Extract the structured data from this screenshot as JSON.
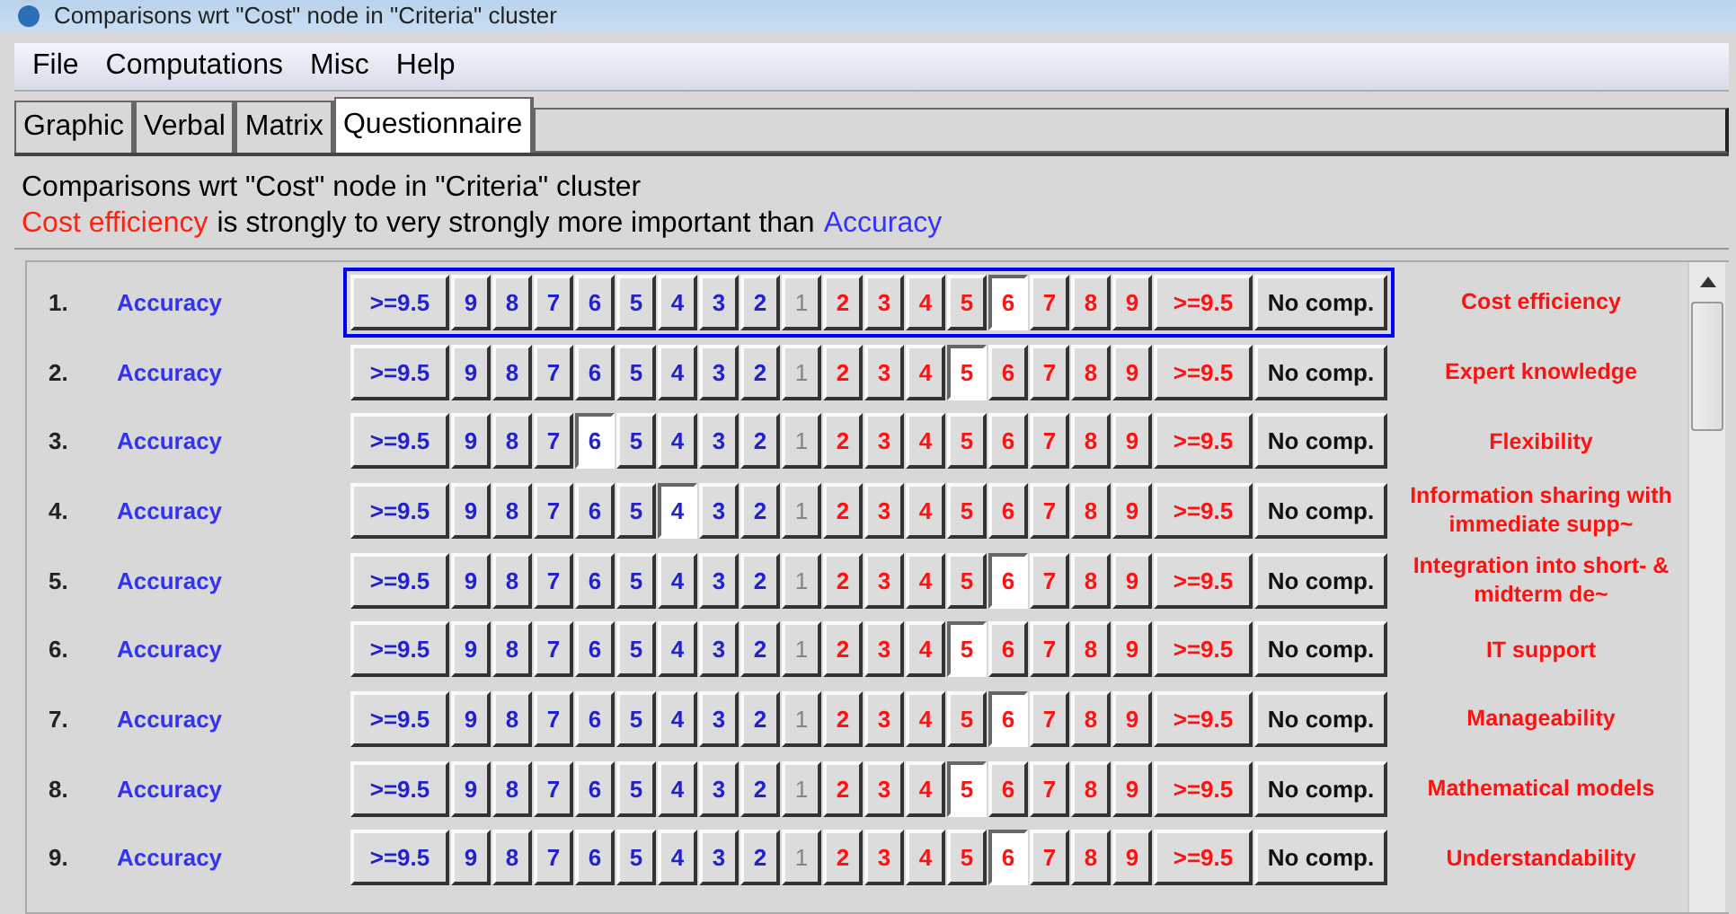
{
  "window": {
    "title": "Comparisons wrt \"Cost\" node in \"Criteria\" cluster"
  },
  "menu": [
    "File",
    "Computations",
    "Misc",
    "Help"
  ],
  "tabs": [
    {
      "label": "Graphic",
      "selected": false
    },
    {
      "label": "Verbal",
      "selected": false
    },
    {
      "label": "Matrix",
      "selected": false
    },
    {
      "label": "Questionnaire",
      "selected": true
    }
  ],
  "header": {
    "line": "Comparisons wrt \"Cost\" node in \"Criteria\" cluster",
    "verdict_left": "Cost efficiency",
    "verdict_middle": "is strongly to very strongly more important than",
    "verdict_right": "Accuracy"
  },
  "rows": [
    {
      "number": "1.",
      "left": "Accuracy",
      "right": "Cost efficiency",
      "focused": true,
      "scale": [
        {
          "label": ">=9.5",
          "kind": "left",
          "selected": false
        },
        {
          "label": "9",
          "kind": "left",
          "selected": false
        },
        {
          "label": "8",
          "kind": "left",
          "selected": false
        },
        {
          "label": "7",
          "kind": "left",
          "selected": false
        },
        {
          "label": "6",
          "kind": "left",
          "selected": false
        },
        {
          "label": "5",
          "kind": "left",
          "selected": false
        },
        {
          "label": "4",
          "kind": "left",
          "selected": false
        },
        {
          "label": "3",
          "kind": "left",
          "selected": false
        },
        {
          "label": "2",
          "kind": "left",
          "selected": false
        },
        {
          "label": "1",
          "kind": "equal",
          "selected": false
        },
        {
          "label": "2",
          "kind": "right",
          "selected": false
        },
        {
          "label": "3",
          "kind": "right",
          "selected": false
        },
        {
          "label": "4",
          "kind": "right",
          "selected": false
        },
        {
          "label": "5",
          "kind": "right",
          "selected": false
        },
        {
          "label": "6",
          "kind": "right",
          "selected": true
        },
        {
          "label": "7",
          "kind": "right",
          "selected": false
        },
        {
          "label": "8",
          "kind": "right",
          "selected": false
        },
        {
          "label": "9",
          "kind": "right",
          "selected": false
        },
        {
          "label": ">=9.5",
          "kind": "right",
          "selected": false
        },
        {
          "label": "No comp.",
          "kind": "none",
          "selected": false
        }
      ]
    },
    {
      "number": "2.",
      "left": "Accuracy",
      "right": "Expert knowledge",
      "focused": false,
      "scale": [
        {
          "label": ">=9.5",
          "kind": "left",
          "selected": false
        },
        {
          "label": "9",
          "kind": "left",
          "selected": false
        },
        {
          "label": "8",
          "kind": "left",
          "selected": false
        },
        {
          "label": "7",
          "kind": "left",
          "selected": false
        },
        {
          "label": "6",
          "kind": "left",
          "selected": false
        },
        {
          "label": "5",
          "kind": "left",
          "selected": false
        },
        {
          "label": "4",
          "kind": "left",
          "selected": false
        },
        {
          "label": "3",
          "kind": "left",
          "selected": false
        },
        {
          "label": "2",
          "kind": "left",
          "selected": false
        },
        {
          "label": "1",
          "kind": "equal",
          "selected": false
        },
        {
          "label": "2",
          "kind": "right",
          "selected": false
        },
        {
          "label": "3",
          "kind": "right",
          "selected": false
        },
        {
          "label": "4",
          "kind": "right",
          "selected": false
        },
        {
          "label": "5",
          "kind": "right",
          "selected": true
        },
        {
          "label": "6",
          "kind": "right",
          "selected": false
        },
        {
          "label": "7",
          "kind": "right",
          "selected": false
        },
        {
          "label": "8",
          "kind": "right",
          "selected": false
        },
        {
          "label": "9",
          "kind": "right",
          "selected": false
        },
        {
          "label": ">=9.5",
          "kind": "right",
          "selected": false
        },
        {
          "label": "No comp.",
          "kind": "none",
          "selected": false
        }
      ]
    },
    {
      "number": "3.",
      "left": "Accuracy",
      "right": "Flexibility",
      "focused": false,
      "scale": [
        {
          "label": ">=9.5",
          "kind": "left",
          "selected": false
        },
        {
          "label": "9",
          "kind": "left",
          "selected": false
        },
        {
          "label": "8",
          "kind": "left",
          "selected": false
        },
        {
          "label": "7",
          "kind": "left",
          "selected": false
        },
        {
          "label": "6",
          "kind": "left",
          "selected": true
        },
        {
          "label": "5",
          "kind": "left",
          "selected": false
        },
        {
          "label": "4",
          "kind": "left",
          "selected": false
        },
        {
          "label": "3",
          "kind": "left",
          "selected": false
        },
        {
          "label": "2",
          "kind": "left",
          "selected": false
        },
        {
          "label": "1",
          "kind": "equal",
          "selected": false
        },
        {
          "label": "2",
          "kind": "right",
          "selected": false
        },
        {
          "label": "3",
          "kind": "right",
          "selected": false
        },
        {
          "label": "4",
          "kind": "right",
          "selected": false
        },
        {
          "label": "5",
          "kind": "right",
          "selected": false
        },
        {
          "label": "6",
          "kind": "right",
          "selected": false
        },
        {
          "label": "7",
          "kind": "right",
          "selected": false
        },
        {
          "label": "8",
          "kind": "right",
          "selected": false
        },
        {
          "label": "9",
          "kind": "right",
          "selected": false
        },
        {
          "label": ">=9.5",
          "kind": "right",
          "selected": false
        },
        {
          "label": "No comp.",
          "kind": "none",
          "selected": false
        }
      ]
    },
    {
      "number": "4.",
      "left": "Accuracy",
      "right": "Information sharing with immediate supp~",
      "focused": false,
      "scale": [
        {
          "label": ">=9.5",
          "kind": "left",
          "selected": false
        },
        {
          "label": "9",
          "kind": "left",
          "selected": false
        },
        {
          "label": "8",
          "kind": "left",
          "selected": false
        },
        {
          "label": "7",
          "kind": "left",
          "selected": false
        },
        {
          "label": "6",
          "kind": "left",
          "selected": false
        },
        {
          "label": "5",
          "kind": "left",
          "selected": false
        },
        {
          "label": "4",
          "kind": "left",
          "selected": true
        },
        {
          "label": "3",
          "kind": "left",
          "selected": false
        },
        {
          "label": "2",
          "kind": "left",
          "selected": false
        },
        {
          "label": "1",
          "kind": "equal",
          "selected": false
        },
        {
          "label": "2",
          "kind": "right",
          "selected": false
        },
        {
          "label": "3",
          "kind": "right",
          "selected": false
        },
        {
          "label": "4",
          "kind": "right",
          "selected": false
        },
        {
          "label": "5",
          "kind": "right",
          "selected": false
        },
        {
          "label": "6",
          "kind": "right",
          "selected": false
        },
        {
          "label": "7",
          "kind": "right",
          "selected": false
        },
        {
          "label": "8",
          "kind": "right",
          "selected": false
        },
        {
          "label": "9",
          "kind": "right",
          "selected": false
        },
        {
          "label": ">=9.5",
          "kind": "right",
          "selected": false
        },
        {
          "label": "No comp.",
          "kind": "none",
          "selected": false
        }
      ]
    },
    {
      "number": "5.",
      "left": "Accuracy",
      "right": "Integration into short- & midterm de~",
      "focused": false,
      "scale": [
        {
          "label": ">=9.5",
          "kind": "left",
          "selected": false
        },
        {
          "label": "9",
          "kind": "left",
          "selected": false
        },
        {
          "label": "8",
          "kind": "left",
          "selected": false
        },
        {
          "label": "7",
          "kind": "left",
          "selected": false
        },
        {
          "label": "6",
          "kind": "left",
          "selected": false
        },
        {
          "label": "5",
          "kind": "left",
          "selected": false
        },
        {
          "label": "4",
          "kind": "left",
          "selected": false
        },
        {
          "label": "3",
          "kind": "left",
          "selected": false
        },
        {
          "label": "2",
          "kind": "left",
          "selected": false
        },
        {
          "label": "1",
          "kind": "equal",
          "selected": false
        },
        {
          "label": "2",
          "kind": "right",
          "selected": false
        },
        {
          "label": "3",
          "kind": "right",
          "selected": false
        },
        {
          "label": "4",
          "kind": "right",
          "selected": false
        },
        {
          "label": "5",
          "kind": "right",
          "selected": false
        },
        {
          "label": "6",
          "kind": "right",
          "selected": true
        },
        {
          "label": "7",
          "kind": "right",
          "selected": false
        },
        {
          "label": "8",
          "kind": "right",
          "selected": false
        },
        {
          "label": "9",
          "kind": "right",
          "selected": false
        },
        {
          "label": ">=9.5",
          "kind": "right",
          "selected": false
        },
        {
          "label": "No comp.",
          "kind": "none",
          "selected": false
        }
      ]
    },
    {
      "number": "6.",
      "left": "Accuracy",
      "right": "IT support",
      "focused": false,
      "scale": [
        {
          "label": ">=9.5",
          "kind": "left",
          "selected": false
        },
        {
          "label": "9",
          "kind": "left",
          "selected": false
        },
        {
          "label": "8",
          "kind": "left",
          "selected": false
        },
        {
          "label": "7",
          "kind": "left",
          "selected": false
        },
        {
          "label": "6",
          "kind": "left",
          "selected": false
        },
        {
          "label": "5",
          "kind": "left",
          "selected": false
        },
        {
          "label": "4",
          "kind": "left",
          "selected": false
        },
        {
          "label": "3",
          "kind": "left",
          "selected": false
        },
        {
          "label": "2",
          "kind": "left",
          "selected": false
        },
        {
          "label": "1",
          "kind": "equal",
          "selected": false
        },
        {
          "label": "2",
          "kind": "right",
          "selected": false
        },
        {
          "label": "3",
          "kind": "right",
          "selected": false
        },
        {
          "label": "4",
          "kind": "right",
          "selected": false
        },
        {
          "label": "5",
          "kind": "right",
          "selected": true
        },
        {
          "label": "6",
          "kind": "right",
          "selected": false
        },
        {
          "label": "7",
          "kind": "right",
          "selected": false
        },
        {
          "label": "8",
          "kind": "right",
          "selected": false
        },
        {
          "label": "9",
          "kind": "right",
          "selected": false
        },
        {
          "label": ">=9.5",
          "kind": "right",
          "selected": false
        },
        {
          "label": "No comp.",
          "kind": "none",
          "selected": false
        }
      ]
    },
    {
      "number": "7.",
      "left": "Accuracy",
      "right": "Manageability",
      "focused": false,
      "scale": [
        {
          "label": ">=9.5",
          "kind": "left",
          "selected": false
        },
        {
          "label": "9",
          "kind": "left",
          "selected": false
        },
        {
          "label": "8",
          "kind": "left",
          "selected": false
        },
        {
          "label": "7",
          "kind": "left",
          "selected": false
        },
        {
          "label": "6",
          "kind": "left",
          "selected": false
        },
        {
          "label": "5",
          "kind": "left",
          "selected": false
        },
        {
          "label": "4",
          "kind": "left",
          "selected": false
        },
        {
          "label": "3",
          "kind": "left",
          "selected": false
        },
        {
          "label": "2",
          "kind": "left",
          "selected": false
        },
        {
          "label": "1",
          "kind": "equal",
          "selected": false
        },
        {
          "label": "2",
          "kind": "right",
          "selected": false
        },
        {
          "label": "3",
          "kind": "right",
          "selected": false
        },
        {
          "label": "4",
          "kind": "right",
          "selected": false
        },
        {
          "label": "5",
          "kind": "right",
          "selected": false
        },
        {
          "label": "6",
          "kind": "right",
          "selected": true
        },
        {
          "label": "7",
          "kind": "right",
          "selected": false
        },
        {
          "label": "8",
          "kind": "right",
          "selected": false
        },
        {
          "label": "9",
          "kind": "right",
          "selected": false
        },
        {
          "label": ">=9.5",
          "kind": "right",
          "selected": false
        },
        {
          "label": "No comp.",
          "kind": "none",
          "selected": false
        }
      ]
    },
    {
      "number": "8.",
      "left": "Accuracy",
      "right": "Mathematical models",
      "focused": false,
      "scale": [
        {
          "label": ">=9.5",
          "kind": "left",
          "selected": false
        },
        {
          "label": "9",
          "kind": "left",
          "selected": false
        },
        {
          "label": "8",
          "kind": "left",
          "selected": false
        },
        {
          "label": "7",
          "kind": "left",
          "selected": false
        },
        {
          "label": "6",
          "kind": "left",
          "selected": false
        },
        {
          "label": "5",
          "kind": "left",
          "selected": false
        },
        {
          "label": "4",
          "kind": "left",
          "selected": false
        },
        {
          "label": "3",
          "kind": "left",
          "selected": false
        },
        {
          "label": "2",
          "kind": "left",
          "selected": false
        },
        {
          "label": "1",
          "kind": "equal",
          "selected": false
        },
        {
          "label": "2",
          "kind": "right",
          "selected": false
        },
        {
          "label": "3",
          "kind": "right",
          "selected": false
        },
        {
          "label": "4",
          "kind": "right",
          "selected": false
        },
        {
          "label": "5",
          "kind": "right",
          "selected": true
        },
        {
          "label": "6",
          "kind": "right",
          "selected": false
        },
        {
          "label": "7",
          "kind": "right",
          "selected": false
        },
        {
          "label": "8",
          "kind": "right",
          "selected": false
        },
        {
          "label": "9",
          "kind": "right",
          "selected": false
        },
        {
          "label": ">=9.5",
          "kind": "right",
          "selected": false
        },
        {
          "label": "No comp.",
          "kind": "none",
          "selected": false
        }
      ]
    },
    {
      "number": "9.",
      "left": "Accuracy",
      "right": "Understandability",
      "focused": false,
      "scale": [
        {
          "label": ">=9.5",
          "kind": "left",
          "selected": false
        },
        {
          "label": "9",
          "kind": "left",
          "selected": false
        },
        {
          "label": "8",
          "kind": "left",
          "selected": false
        },
        {
          "label": "7",
          "kind": "left",
          "selected": false
        },
        {
          "label": "6",
          "kind": "left",
          "selected": false
        },
        {
          "label": "5",
          "kind": "left",
          "selected": false
        },
        {
          "label": "4",
          "kind": "left",
          "selected": false
        },
        {
          "label": "3",
          "kind": "left",
          "selected": false
        },
        {
          "label": "2",
          "kind": "left",
          "selected": false
        },
        {
          "label": "1",
          "kind": "equal",
          "selected": false
        },
        {
          "label": "2",
          "kind": "right",
          "selected": false
        },
        {
          "label": "3",
          "kind": "right",
          "selected": false
        },
        {
          "label": "4",
          "kind": "right",
          "selected": false
        },
        {
          "label": "5",
          "kind": "right",
          "selected": false
        },
        {
          "label": "6",
          "kind": "right",
          "selected": true
        },
        {
          "label": "7",
          "kind": "right",
          "selected": false
        },
        {
          "label": "8",
          "kind": "right",
          "selected": false
        },
        {
          "label": "9",
          "kind": "right",
          "selected": false
        },
        {
          "label": ">=9.5",
          "kind": "right",
          "selected": false
        },
        {
          "label": "No comp.",
          "kind": "none",
          "selected": false
        }
      ]
    }
  ]
}
